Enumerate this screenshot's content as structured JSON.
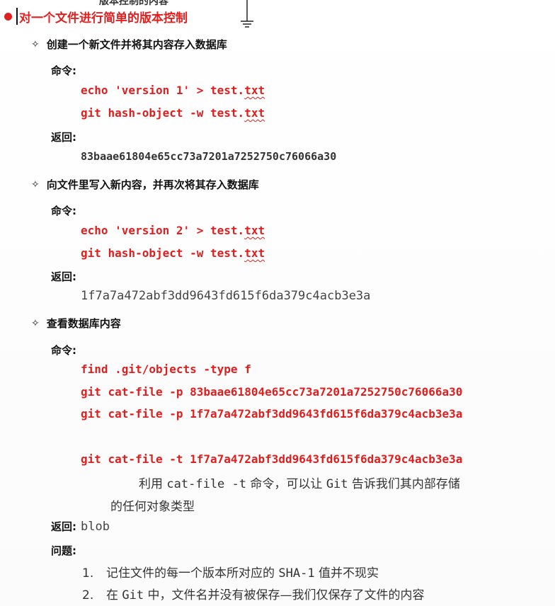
{
  "top_cut_text": "版本控制的内容",
  "title": "对一个文件进行简单的版本控制",
  "sections": [
    {
      "heading": "创建一个新文件并将其内容存入数据库",
      "command_label": "命令:",
      "cmd1_pre": "echo 'version 1' > test.",
      "cmd1_ext": "txt",
      "cmd2_pre": "git hash-object -w test.",
      "cmd2_ext": "txt",
      "return_label": "返回:",
      "return_value": "83baae61804e65cc73a7201a7252750c76066a30"
    },
    {
      "heading": "向文件里写入新内容，并再次将其存入数据库",
      "command_label": "命令:",
      "cmd1_pre": "echo 'version 2' > test.",
      "cmd1_ext": "txt",
      "cmd2_pre": "git hash-object -w test.",
      "cmd2_ext": "txt",
      "return_label": "返回:",
      "return_value": "1f7a7a472abf3dd9643fd615f6da379c4acb3e3a"
    },
    {
      "heading": "查看数据库内容",
      "command_label": "命令:",
      "cmds": [
        "find .git/objects -type f",
        "git cat-file -p 83baae61804e65cc73a7201a7252750c76066a30",
        "git cat-file -p 1f7a7a472abf3dd9643fd615f6da379c4acb3e3a",
        "git cat-file -t 1f7a7a472abf3dd9643fd615f6da379c4acb3e3a"
      ],
      "note_part1": "利用 ",
      "note_cmd": "cat-file -t",
      "note_part2": " 命令，可以让 ",
      "note_git": "Git",
      "note_part3": " 告诉我们其内部存储",
      "note_line2": "的任何对象类型",
      "return_label": "返回:",
      "return_value": "blob",
      "issues_label": "问题:",
      "issues": [
        {
          "num": "1.",
          "pre": "记住文件的每一个版本所对应的 ",
          "mono": "SHA-1",
          "post": " 值并不现实"
        },
        {
          "num": "2.",
          "pre": "在 ",
          "mono": "Git",
          "post": " 中，文件名并没有被保存—我们仅保存了文件的内容"
        }
      ]
    }
  ],
  "colors": {
    "accent_red": "#e01e1e",
    "text_dark": "#111111",
    "text_gray": "#444444"
  }
}
